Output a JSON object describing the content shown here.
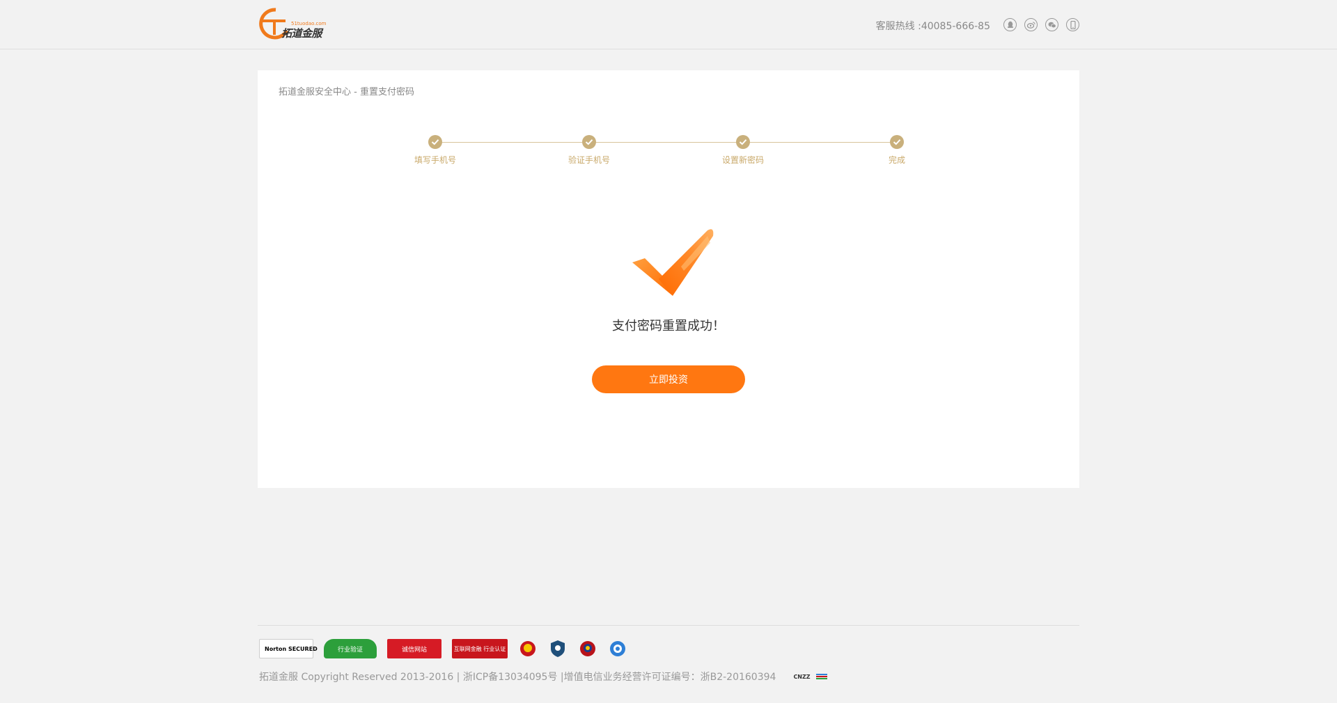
{
  "header": {
    "logo_text": "拓道金服",
    "logo_domain": "51tuodao.com",
    "hotline": "客服热线 :40085-666-85",
    "social_icons": [
      "qq-icon",
      "weibo-icon",
      "wechat-icon",
      "mobile-icon"
    ]
  },
  "breadcrumb": "拓道金服安全中心 - 重置支付密码",
  "steps": [
    {
      "label": "填写手机号",
      "done": true
    },
    {
      "label": "验证手机号",
      "done": true
    },
    {
      "label": "设置新密码",
      "done": true
    },
    {
      "label": "完成",
      "done": true
    }
  ],
  "result": {
    "message": "支付密码重置成功！",
    "button_label": "立即投资"
  },
  "footer": {
    "badges": [
      {
        "name": "norton-secured-badge",
        "text": "Norton SECURED"
      },
      {
        "name": "industry-verification-badge",
        "text": "行业验证"
      },
      {
        "name": "credit-website-badge",
        "text": "诚信网站"
      },
      {
        "name": "internet-finance-badge",
        "text": "互联网金融 行业认证"
      },
      {
        "name": "police-badge-1",
        "text": ""
      },
      {
        "name": "shield-badge",
        "text": ""
      },
      {
        "name": "police-badge-2",
        "text": ""
      },
      {
        "name": "security-badge",
        "text": ""
      }
    ],
    "copyright": "拓道金服 Copyright Reserved 2013-2016 | 浙ICP备13034095号 |增值电信业务经营许可证编号：浙B2-20160394",
    "mini_logo": "CNZZ"
  },
  "colors": {
    "accent": "#ff7711",
    "step": "#c9b07c",
    "background": "#f2f2f2"
  }
}
